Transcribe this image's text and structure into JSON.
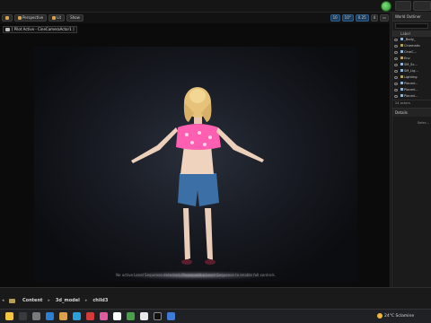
{
  "viewport": {
    "perspective_label": "Perspective",
    "lit_label": "Lit",
    "show_label": "Show",
    "pilot_label": "[ Pilot Active - CineCameraActor1 ]",
    "grid_value": "10",
    "angle_value": "10°",
    "scale_value": "0.25",
    "camera_speed": "4",
    "scene_caption": "No active Level Sequence detected. Please edit a Level Sequence to enable full controls."
  },
  "outliner": {
    "title": "World Outliner",
    "column_label": "Label",
    "rows": [
      {
        "label": "_Body_",
        "folder": false
      },
      {
        "label": "Cinematic",
        "folder": true
      },
      {
        "label": "CineC...",
        "folder": false
      },
      {
        "label": "Env",
        "folder": true
      },
      {
        "label": "SM_Sc...",
        "folder": false
      },
      {
        "label": "SM_Lig...",
        "folder": false
      },
      {
        "label": "Lighting",
        "folder": true
      },
      {
        "label": "Placed...",
        "folder": false
      },
      {
        "label": "Placed...",
        "folder": false
      },
      {
        "label": "Placed...",
        "folder": false
      }
    ],
    "count": "24 actors"
  },
  "details": {
    "title": "Details",
    "hint": "Selec..."
  },
  "content_browser": {
    "crumbs": [
      "Content",
      "3d_model",
      "child3"
    ]
  },
  "taskbar": {
    "weather": "24°C  Sclamine"
  },
  "colors": {
    "accent_green": "#3fbf3f",
    "folder": "#b49c5a",
    "pink_top": "#ff5fb0",
    "denim": "#3c6fa6",
    "hair": "#e6c27a"
  }
}
